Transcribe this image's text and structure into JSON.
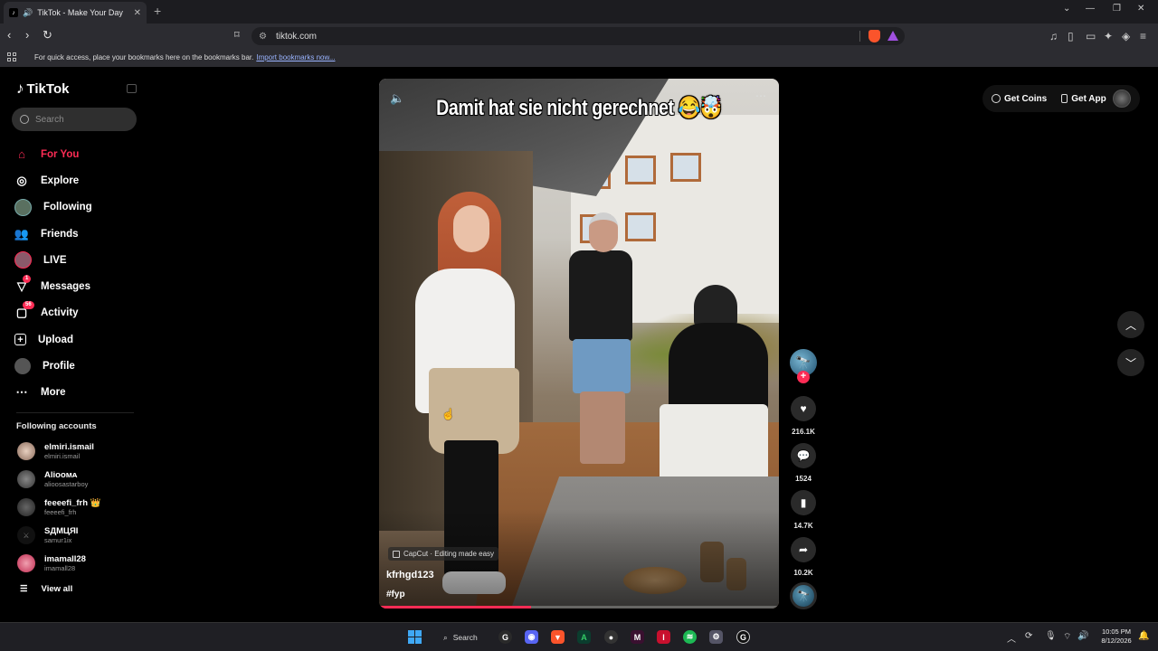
{
  "browser": {
    "tab_title": "TikTok - Make Your Day",
    "url": "tiktok.com",
    "bookmarks_text": "For quick access, place your bookmarks here on the bookmarks bar.",
    "bookmarks_link": "Import bookmarks now..."
  },
  "sidebar": {
    "logo": "TikTok",
    "search_placeholder": "Search",
    "nav": [
      {
        "label": "For You",
        "icon": "home-icon",
        "active": true
      },
      {
        "label": "Explore",
        "icon": "compass-icon"
      },
      {
        "label": "Following",
        "icon": "following-avatar-icon"
      },
      {
        "label": "Friends",
        "icon": "friends-icon"
      },
      {
        "label": "LIVE",
        "icon": "live-icon"
      },
      {
        "label": "Messages",
        "icon": "messages-icon",
        "badge": "1"
      },
      {
        "label": "Activity",
        "icon": "activity-icon",
        "badge": "56"
      },
      {
        "label": "Upload",
        "icon": "upload-icon"
      },
      {
        "label": "Profile",
        "icon": "profile-icon"
      },
      {
        "label": "More",
        "icon": "more-icon"
      }
    ],
    "following_title": "Following accounts",
    "accounts": [
      {
        "name": "elmiri.ismail",
        "handle": "elmiri.ismail"
      },
      {
        "name": "Aliooᴍᴀ",
        "handle": "alioosastarboy"
      },
      {
        "name": "feeeefi_frh 👑",
        "handle": "feeeefi_frh"
      },
      {
        "name": "SДMЦЯІ",
        "handle": "samur1ix"
      },
      {
        "name": "imamall28",
        "handle": "imamall28"
      }
    ],
    "view_all": "View all"
  },
  "video": {
    "caption": "Damit hat sie nicht gerechnet 😂🤯",
    "capcut": "CapCut · Editing made easy",
    "username": "kfrhgd123",
    "hashtag": "#fyp",
    "progress": 0.38
  },
  "actions": {
    "likes": "216.1K",
    "comments": "1524",
    "saves": "14.7K",
    "shares": "10.2K"
  },
  "topbar": {
    "get_coins": "Get Coins",
    "get_app": "Get App"
  },
  "taskbar": {
    "search": "Search",
    "time": "10:05 PM",
    "date": "8/12/2026"
  },
  "colors": {
    "accent": "#fe2c55",
    "background": "#000000"
  }
}
